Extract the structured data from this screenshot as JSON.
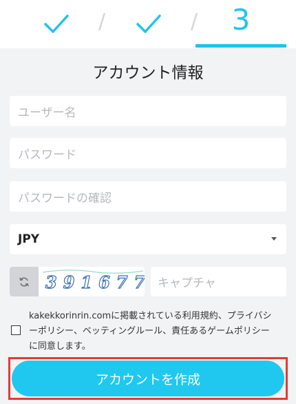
{
  "stepper": {
    "steps": [
      {
        "state": "done",
        "icon": "check-icon"
      },
      {
        "state": "done",
        "icon": "check-icon"
      },
      {
        "state": "current",
        "label": "3"
      }
    ],
    "separator": "/"
  },
  "form": {
    "title": "アカウント情報",
    "username_placeholder": "ユーザー名",
    "password_placeholder": "パスワード",
    "password_confirm_placeholder": "パスワードの確認",
    "currency_value": "JPY",
    "captcha_code": "391677",
    "captcha_placeholder": "キャプチャ",
    "agreement_text": "kakekkorinrin.comに掲載されている利用規約、プライバシーポリシー、ベッティングルール、責任あるゲームポリシーに同意します。",
    "submit_label": "アカウントを作成"
  },
  "colors": {
    "accent": "#1fc4ea",
    "highlight": "#e53935"
  }
}
